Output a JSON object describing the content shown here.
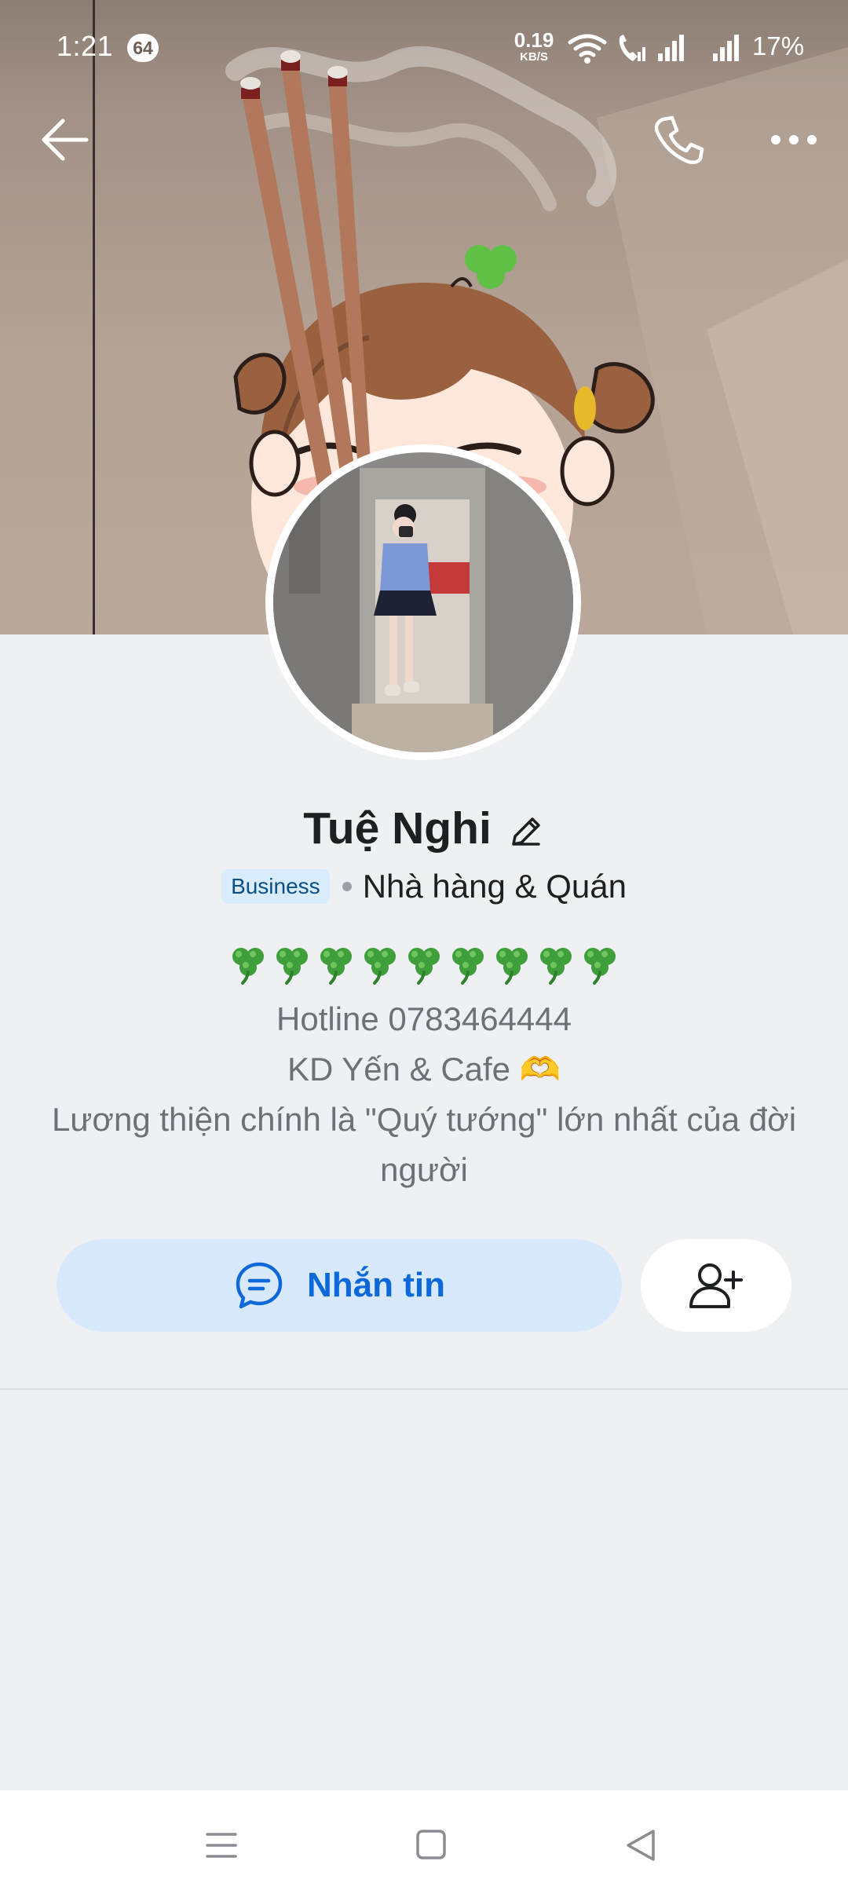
{
  "status_bar": {
    "time": "1:21",
    "notification_count": "64",
    "net_speed_value": "0.19",
    "net_speed_unit": "KB/S",
    "battery": "17%",
    "icons": [
      "wifi-icon",
      "wifi-call-icon",
      "signal-icon",
      "signal-icon"
    ]
  },
  "top_bar": {
    "back_icon": "arrow-left-icon",
    "call_icon": "phone-icon",
    "more_icon": "more-dots-icon"
  },
  "profile": {
    "name": "Tuệ Nghi",
    "edit_icon": "pencil-icon",
    "business_tag": "Business",
    "category": "Nhà hàng & Quán",
    "bio_emoji_count": 9,
    "bio_lines": [
      "Hotline 0783464444",
      "KD Yến & Cafe 🫶",
      "Lương thiện chính là \"Quý tướng\" lớn nhất của đời",
      "người"
    ]
  },
  "actions": {
    "message_label": "Nhắn tin",
    "message_icon": "chat-bubble-icon",
    "add_friend_icon": "add-user-icon"
  },
  "colors": {
    "accent": "#0d68da",
    "message_button_bg": "#d8e8fd",
    "business_tag_bg": "#d9ecfb",
    "page_bg": "#eff0f4"
  },
  "nav_bar": {
    "icons": [
      "menu-lines-icon",
      "home-square-icon",
      "back-triangle-icon"
    ]
  }
}
